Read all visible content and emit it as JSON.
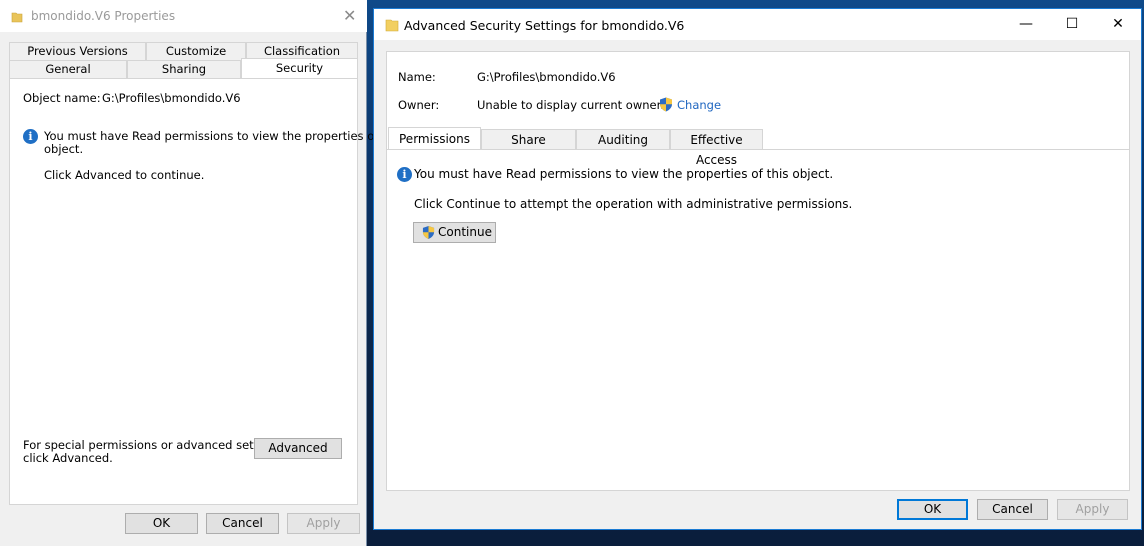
{
  "properties_window": {
    "title": "bmondido.V6 Properties",
    "tabs_row1": [
      "Previous Versions",
      "Customize",
      "Classification"
    ],
    "tabs_row2": [
      "General",
      "Sharing",
      "Security"
    ],
    "active_tab": "Security",
    "object_name_label": "Object name:",
    "object_name_value": "G:\\Profiles\\bmondido.V6",
    "info_line1": "You must have Read permissions to view the properties of this",
    "info_line2": "object.",
    "click_advanced": "Click Advanced to continue.",
    "special_line1": "For special permissions or advanced settings,",
    "special_line2": "click Advanced.",
    "advanced_button": "Advanced",
    "ok_button": "OK",
    "cancel_button": "Cancel",
    "apply_button": "Apply"
  },
  "advanced_window": {
    "title": "Advanced Security Settings for bmondido.V6",
    "name_label": "Name:",
    "name_value": "G:\\Profiles\\bmondido.V6",
    "owner_label": "Owner:",
    "owner_value": "Unable to display current owner.",
    "change_link": "Change",
    "tabs": [
      "Permissions",
      "Share",
      "Auditing",
      "Effective Access"
    ],
    "active_tab": "Permissions",
    "info_text": "You must have Read permissions to view the properties of this object.",
    "continue_text": "Click Continue to attempt the operation with administrative permissions.",
    "continue_button": "Continue",
    "ok_button": "OK",
    "cancel_button": "Cancel",
    "apply_button": "Apply",
    "caption_buttons": {
      "minimize": "—",
      "maximize": "☐",
      "close": "✕"
    }
  },
  "colors": {
    "accent": "#0078d7",
    "link": "#1f66c0",
    "info_icon": "#1f6fc5"
  }
}
